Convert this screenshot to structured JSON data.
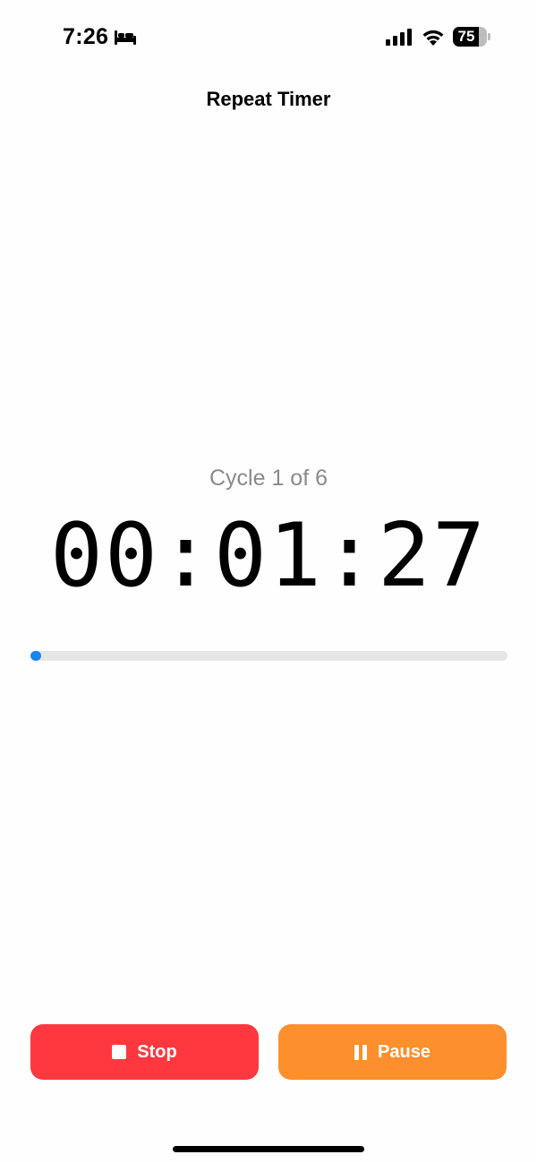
{
  "status_bar": {
    "time": "7:26",
    "focus_icon": "bed-icon",
    "battery_level": "75",
    "battery_fraction": 0.75
  },
  "nav": {
    "title": "Repeat Timer"
  },
  "timer": {
    "cycle_label": "Cycle 1 of 6",
    "display": "00:01:27",
    "progress_fraction": 0.02,
    "accent_color": "#1a84f5"
  },
  "buttons": {
    "stop_label": "Stop",
    "stop_icon": "stop-icon",
    "stop_color": "#ff383f",
    "pause_label": "Pause",
    "pause_icon": "pause-icon",
    "pause_color": "#fd8f2c"
  }
}
